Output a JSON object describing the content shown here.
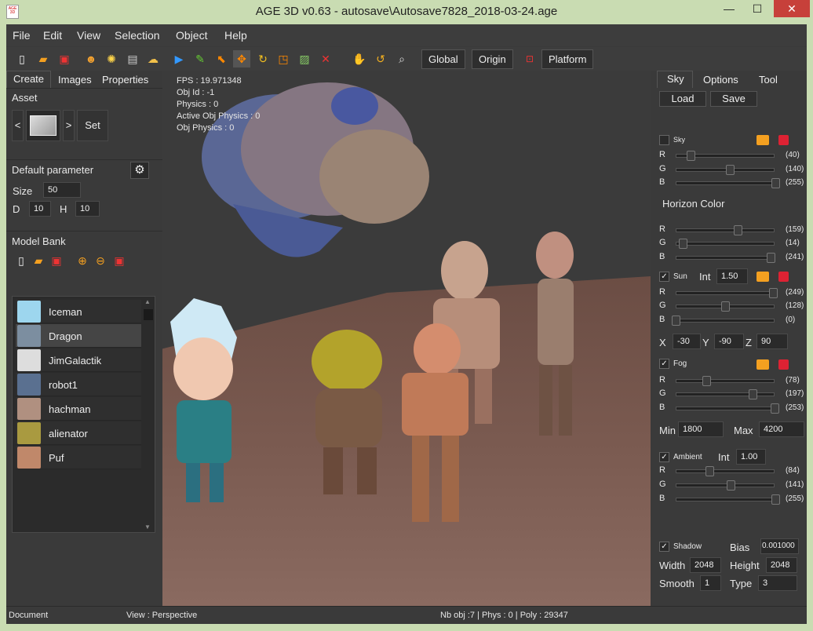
{
  "window": {
    "title": "AGE 3D v0.63 - autosave\\Autosave7828_2018-03-24.age",
    "minimize": "—",
    "maximize": "☐",
    "close": "✕"
  },
  "menu": [
    "File",
    "Edit",
    "View",
    "Selection",
    "Object",
    "Help"
  ],
  "toolbar": {
    "global": "Global",
    "origin": "Origin",
    "platform": "Platform"
  },
  "left": {
    "tabs": [
      "Create",
      "Images",
      "Properties"
    ],
    "asset": {
      "title": "Asset",
      "prev": "<",
      "next": ">",
      "set": "Set"
    },
    "default_param": {
      "title": "Default parameter",
      "size_label": "Size",
      "size": "50",
      "d_label": "D",
      "d": "10",
      "h_label": "H",
      "h": "10"
    },
    "model_bank": {
      "title": "Model Bank",
      "items": [
        "Iceman",
        "Dragon",
        "JimGalactik",
        "robot1",
        "hachman",
        "alienator",
        "Puf"
      ],
      "selected": "Dragon"
    }
  },
  "viewport": {
    "stats": [
      "FPS : 19.971348",
      "Obj Id : -1",
      "Physics : 0",
      "Active Obj Physics : 0",
      "Obj Physics : 0"
    ]
  },
  "right": {
    "tabs": [
      "Sky",
      "Options",
      "Tool"
    ],
    "load": "Load",
    "save": "Save",
    "sky": {
      "label": "Sky",
      "r": "(40)",
      "g": "(140)",
      "b": "(255)"
    },
    "horizon": {
      "title": "Horizon Color",
      "r": "(159)",
      "g": "(14)",
      "b": "(241)"
    },
    "sun": {
      "label": "Sun",
      "int_label": "Int",
      "int": "1.50",
      "r": "(249)",
      "g": "(128)",
      "b": "(0)",
      "x_label": "X",
      "x": "-30",
      "y_label": "Y",
      "y": "-90",
      "z_label": "Z",
      "z": "90"
    },
    "fog": {
      "label": "Fog",
      "r": "(78)",
      "g": "(197)",
      "b": "(253)",
      "min_label": "Min",
      "min": "1800",
      "max_label": "Max",
      "max": "4200"
    },
    "ambient": {
      "label": "Ambient",
      "int_label": "Int",
      "int": "1.00",
      "r": "(84)",
      "g": "(141)",
      "b": "(255)"
    },
    "shadow": {
      "label": "Shadow",
      "bias_label": "Bias",
      "bias": "0.001000",
      "width_label": "Width",
      "width": "2048",
      "height_label": "Height",
      "height": "2048",
      "smooth_label": "Smooth",
      "smooth": "1",
      "type_label": "Type",
      "type": "3"
    },
    "rgb": {
      "r": "R",
      "g": "G",
      "b": "B"
    }
  },
  "status": {
    "left": "Document",
    "view": "View : Perspective",
    "info": "Nb obj :7 | Phys : 0 | Poly : 29347"
  }
}
